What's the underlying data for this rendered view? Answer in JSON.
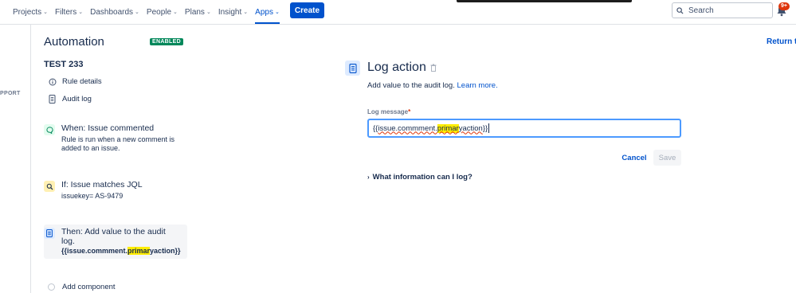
{
  "nav": {
    "items": [
      {
        "label": "Projects"
      },
      {
        "label": "Filters"
      },
      {
        "label": "Dashboards"
      },
      {
        "label": "People"
      },
      {
        "label": "Plans"
      },
      {
        "label": "Insight"
      },
      {
        "label": "Apps",
        "active": true
      }
    ],
    "create_label": "Create",
    "search_placeholder": "Search",
    "notification_count": "9+"
  },
  "left_stub": {
    "text": "PPORT"
  },
  "sidebar": {
    "title": "Automation",
    "status_badge": "ENABLED",
    "rule_name": "TEST 233",
    "links": [
      {
        "label": "Rule details",
        "icon": "info-icon"
      },
      {
        "label": "Audit log",
        "icon": "document-icon"
      }
    ],
    "components": [
      {
        "title": "When: Issue commented",
        "desc": "Rule is run when a new comment is added to an issue.",
        "icon": "comment-trigger-icon",
        "color": "#00875a"
      },
      {
        "title": "If: Issue matches JQL",
        "desc": "issuekey= AS-9479",
        "icon": "search-condition-icon",
        "color": "#ff991f"
      },
      {
        "title_line1": "Then: Add value to the audit",
        "title_line2": "log.",
        "code_pre": "{{issue.commment.",
        "code_hl": "primar",
        "code_post": "yaction}}",
        "icon": "log-action-icon",
        "color": "#0052cc"
      }
    ],
    "add_component": "Add component"
  },
  "main": {
    "title": "Log action",
    "description": "Add value to the audit log.",
    "learn_more": "Learn more.",
    "field_label": "Log message",
    "required_marker": "*",
    "value_pre": "{{",
    "value_sq1": "issue.commment.",
    "value_hl": "primar",
    "value_sq2": "yaction",
    "value_post": "}}",
    "cancel_label": "Cancel",
    "save_label": "Save",
    "what_info_label": "What information can I log?",
    "return_label": "Return to"
  },
  "colors": {
    "accent": "#0052cc",
    "enabled": "#00875a",
    "highlight": "#ffed00",
    "badge": "#de350b"
  }
}
